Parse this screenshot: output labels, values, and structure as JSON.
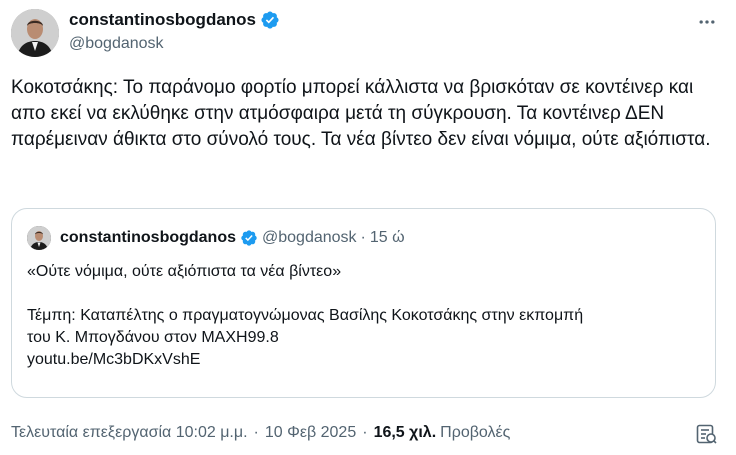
{
  "author": {
    "display_name": "constantinosbogdanos",
    "handle": "@bogdanosk",
    "verified": true,
    "verified_color": "#1d9bf0"
  },
  "tweet": {
    "text": "Κοκοτσάκης: Το παράνομο φορτίο μπορεί κάλλιστα να βρισκόταν σε κοντέινερ και απο εκεί να εκλύθηκε στην ατμόσφαιρα μετά τη σύγκρουση. Τα κοντέινερ ΔΕΝ παρέμειναν άθικτα στο σύνολό τους. Τα νέα βίντεο δεν είναι νόμιμα, ούτε αξιόπιστα."
  },
  "quote": {
    "display_name": "constantinosbogdanos",
    "handle": "@bogdanosk",
    "separator": "·",
    "time": "15 ώ",
    "line1": "«Ούτε νόμιμα, ούτε αξιόπιστα τα νέα βίντεο»",
    "line2": "Τέμπη: Καταπέλτης ο πραγματογνώμονας Βασίλης Κοκοτσάκης στην εκπομπή",
    "line3": "του Κ.  Μπογδάνου στον ΜΑΧΗ99.8",
    "link": "youtu.be/Mc3bDKxVshE"
  },
  "meta": {
    "edited": "Τελευταία επεξεργασία 10:02 μ.μ.",
    "separator": "·",
    "date": "10 Φεβ 2025",
    "views_count": "16,5 χιλ.",
    "views_label": "Προβολές"
  },
  "icons": {
    "more": "more-horizontal-icon",
    "verified": "verified-badge-icon",
    "analytics": "analytics-icon"
  },
  "colors": {
    "text": "#0f1419",
    "secondary": "#536471",
    "border": "#cfd9de",
    "accent": "#1d9bf0"
  }
}
